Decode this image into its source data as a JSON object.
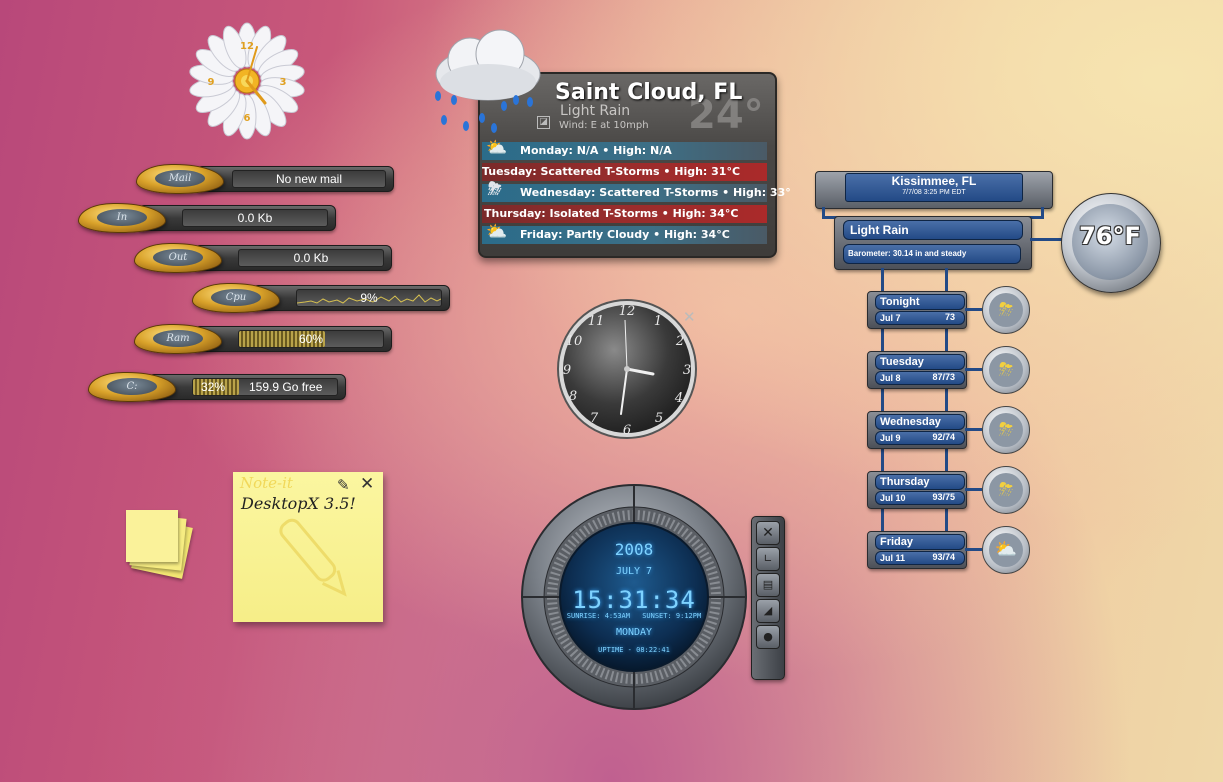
{
  "daisy_clock": {
    "numbers": [
      "12",
      "3",
      "6",
      "9"
    ]
  },
  "system_meters": {
    "mail": {
      "label": "Mail",
      "value": "No new mail"
    },
    "in": {
      "label": "In",
      "value": "0.0 Kb"
    },
    "out": {
      "label": "Out",
      "value": "0.0 Kb"
    },
    "cpu": {
      "label": "Cpu",
      "value": "9%",
      "level": 0.09
    },
    "ram": {
      "label": "Ram",
      "value": "60%",
      "level": 0.6
    },
    "disk": {
      "label": "C:",
      "percent": "32%",
      "free": "159.9 Go free",
      "level": 0.32
    }
  },
  "weather_saint_cloud": {
    "city": "Saint Cloud, FL",
    "temp": "24°",
    "condition": "Light Rain",
    "wind": "Wind: E at 10mph",
    "forecast": [
      {
        "text": "Monday: N/A  •  High: N/A",
        "style": "blue",
        "icon": "partly-cloudy-icon"
      },
      {
        "text": "Tuesday: Scattered T-Storms  •  High: 31°C",
        "style": "red",
        "icon": ""
      },
      {
        "text": "Wednesday: Scattered T-Storms  •  High: 33°",
        "style": "blue",
        "icon": "thunderstorm-icon"
      },
      {
        "text": "Thursday: Isolated T-Storms  •  High: 34°C",
        "style": "red",
        "icon": ""
      },
      {
        "text": "Friday: Partly Cloudy  •  High: 34°C",
        "style": "blue",
        "icon": "partly-cloudy-icon"
      }
    ]
  },
  "analog_clock": {
    "numbers": [
      "12",
      "1",
      "2",
      "3",
      "4",
      "5",
      "6",
      "7",
      "8",
      "9",
      "10",
      "11"
    ]
  },
  "sticky_note": {
    "title": "Note-it",
    "text": "DesktopX 3.5!"
  },
  "digital_clock": {
    "year": "2008",
    "date": "JULY 7",
    "time": "15:31:34",
    "sunrise": "SUNRISE: 4:53AM",
    "sunset": "SUNSET: 9:12PM",
    "weekday": "MONDAY",
    "uptime": "UPTIME - 08:22:41"
  },
  "weather_kissimmee": {
    "city": "Kissimmee, FL",
    "updated": "7/7/08 3:25 PM EDT",
    "condition": "Light Rain",
    "barometer": "Barometer: 30.14 in and steady",
    "temp": "76°F",
    "days": [
      {
        "name": "Tonight",
        "date": "Jul 7",
        "temps": "73",
        "icon": "thunderstorm-icon"
      },
      {
        "name": "Tuesday",
        "date": "Jul 8",
        "temps": "87/73",
        "icon": "sun-thunderstorm-icon"
      },
      {
        "name": "Wednesday",
        "date": "Jul 9",
        "temps": "92/74",
        "icon": "sun-thunderstorm-icon"
      },
      {
        "name": "Thursday",
        "date": "Jul 10",
        "temps": "93/75",
        "icon": "sun-thunderstorm-icon"
      },
      {
        "name": "Friday",
        "date": "Jul 11",
        "temps": "93/74",
        "icon": "partly-cloudy-icon"
      }
    ]
  }
}
